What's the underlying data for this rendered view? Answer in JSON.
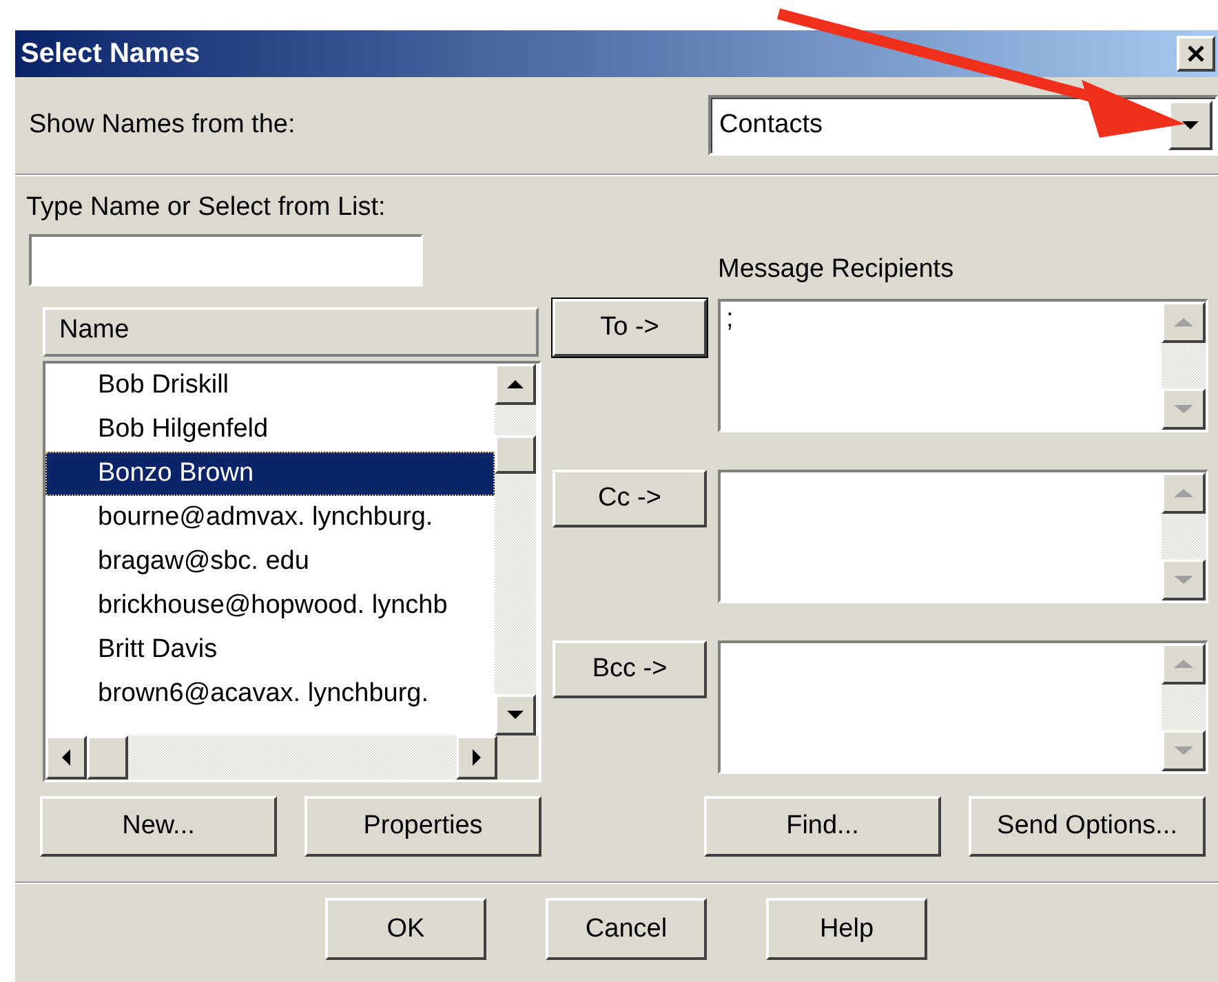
{
  "window": {
    "title": "Select Names"
  },
  "source": {
    "label": "Show Names from the:",
    "value": "Contacts"
  },
  "search": {
    "label": "Type Name or Select from List:"
  },
  "name_list": {
    "header": "Name",
    "rows": [
      {
        "name": "Bob Driskill",
        "selected": false
      },
      {
        "name": "Bob Hilgenfeld",
        "selected": false
      },
      {
        "name": "Bonzo Brown",
        "selected": true
      },
      {
        "name": "bourne@admvax. lynchburg.",
        "selected": false
      },
      {
        "name": "bragaw@sbc. edu",
        "selected": false
      },
      {
        "name": "brickhouse@hopwood. lynchb",
        "selected": false
      },
      {
        "name": "Britt Davis",
        "selected": false
      },
      {
        "name": "brown6@acavax. lynchburg.",
        "selected": false
      }
    ]
  },
  "recipients": {
    "label": "Message Recipients",
    "fields": [
      {
        "button": "To ->",
        "value": ";",
        "default": true
      },
      {
        "button": "Cc ->",
        "default": false
      },
      {
        "button": "Bcc ->",
        "default": false
      }
    ]
  },
  "list_buttons": [
    "New...",
    "Properties",
    "Find...",
    "Send Options..."
  ],
  "dialog_buttons": [
    "OK",
    "Cancel",
    "Help"
  ]
}
